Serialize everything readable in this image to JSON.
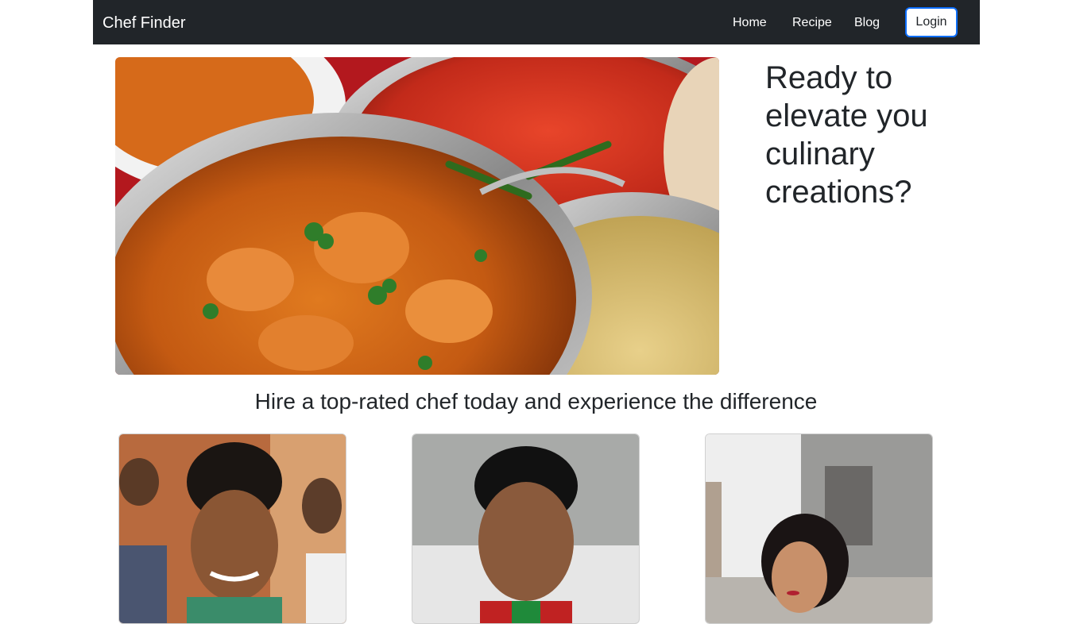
{
  "navbar": {
    "brand": "Chef Finder",
    "links": [
      "Home",
      "Recipe",
      "Blog"
    ],
    "login_label": "Login"
  },
  "hero": {
    "heading": "Ready to elevate you culinary creations?",
    "image": "curry-dishes-photo"
  },
  "tagline": "Hire a top-rated chef today and experience the difference",
  "chefs": [
    {
      "image": "chef-photo-woman"
    },
    {
      "image": "chef-photo-man"
    },
    {
      "image": "chef-photo-woman-outdoor"
    }
  ],
  "colors": {
    "navbar_bg": "#212529",
    "login_border": "#0d6efd",
    "text": "#212529"
  }
}
